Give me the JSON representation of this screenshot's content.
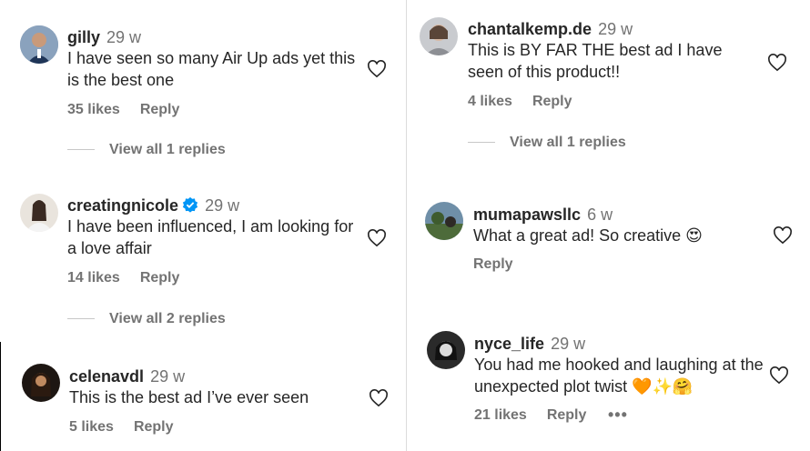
{
  "comments_left": [
    {
      "user": "gilly",
      "time": "29 w",
      "text": "I have seen so many Air Up ads yet this is the best one",
      "likes": "35 likes",
      "reply": "Reply",
      "replies": "View all 1 replies"
    },
    {
      "user": "creatingnicole",
      "time": "29 w",
      "text": "I have been influenced, I am looking for a love affair",
      "likes": "14 likes",
      "reply": "Reply",
      "replies": "View all 2 replies",
      "verified": true
    },
    {
      "user": "celenavdl",
      "time": "29 w",
      "text": "This is the best ad I’ve ever seen",
      "likes": "5 likes",
      "reply": "Reply"
    }
  ],
  "comments_right": [
    {
      "user": "chantalkemp.de",
      "time": "29 w",
      "text": "This is BY FAR THE best ad I have seen of this product!!",
      "likes": "4 likes",
      "reply": "Reply",
      "replies": "View all 1 replies"
    },
    {
      "user": "mumapawsllc",
      "time": "6 w",
      "text": "What a great ad! So creative 😍",
      "reply": "Reply"
    },
    {
      "user": "nyce_life",
      "time": "29 w",
      "text": "You had me hooked and laughing at the unexpected plot twist 🧡✨🤗",
      "likes": "21 likes",
      "reply": "Reply",
      "more": "•••"
    }
  ],
  "icons": {
    "heart": "heart-outline-icon",
    "verified": "verified-badge-icon",
    "more": "more-options-icon"
  },
  "colors": {
    "text": "#262626",
    "secondary": "#737373",
    "verified": "#0095f6"
  }
}
